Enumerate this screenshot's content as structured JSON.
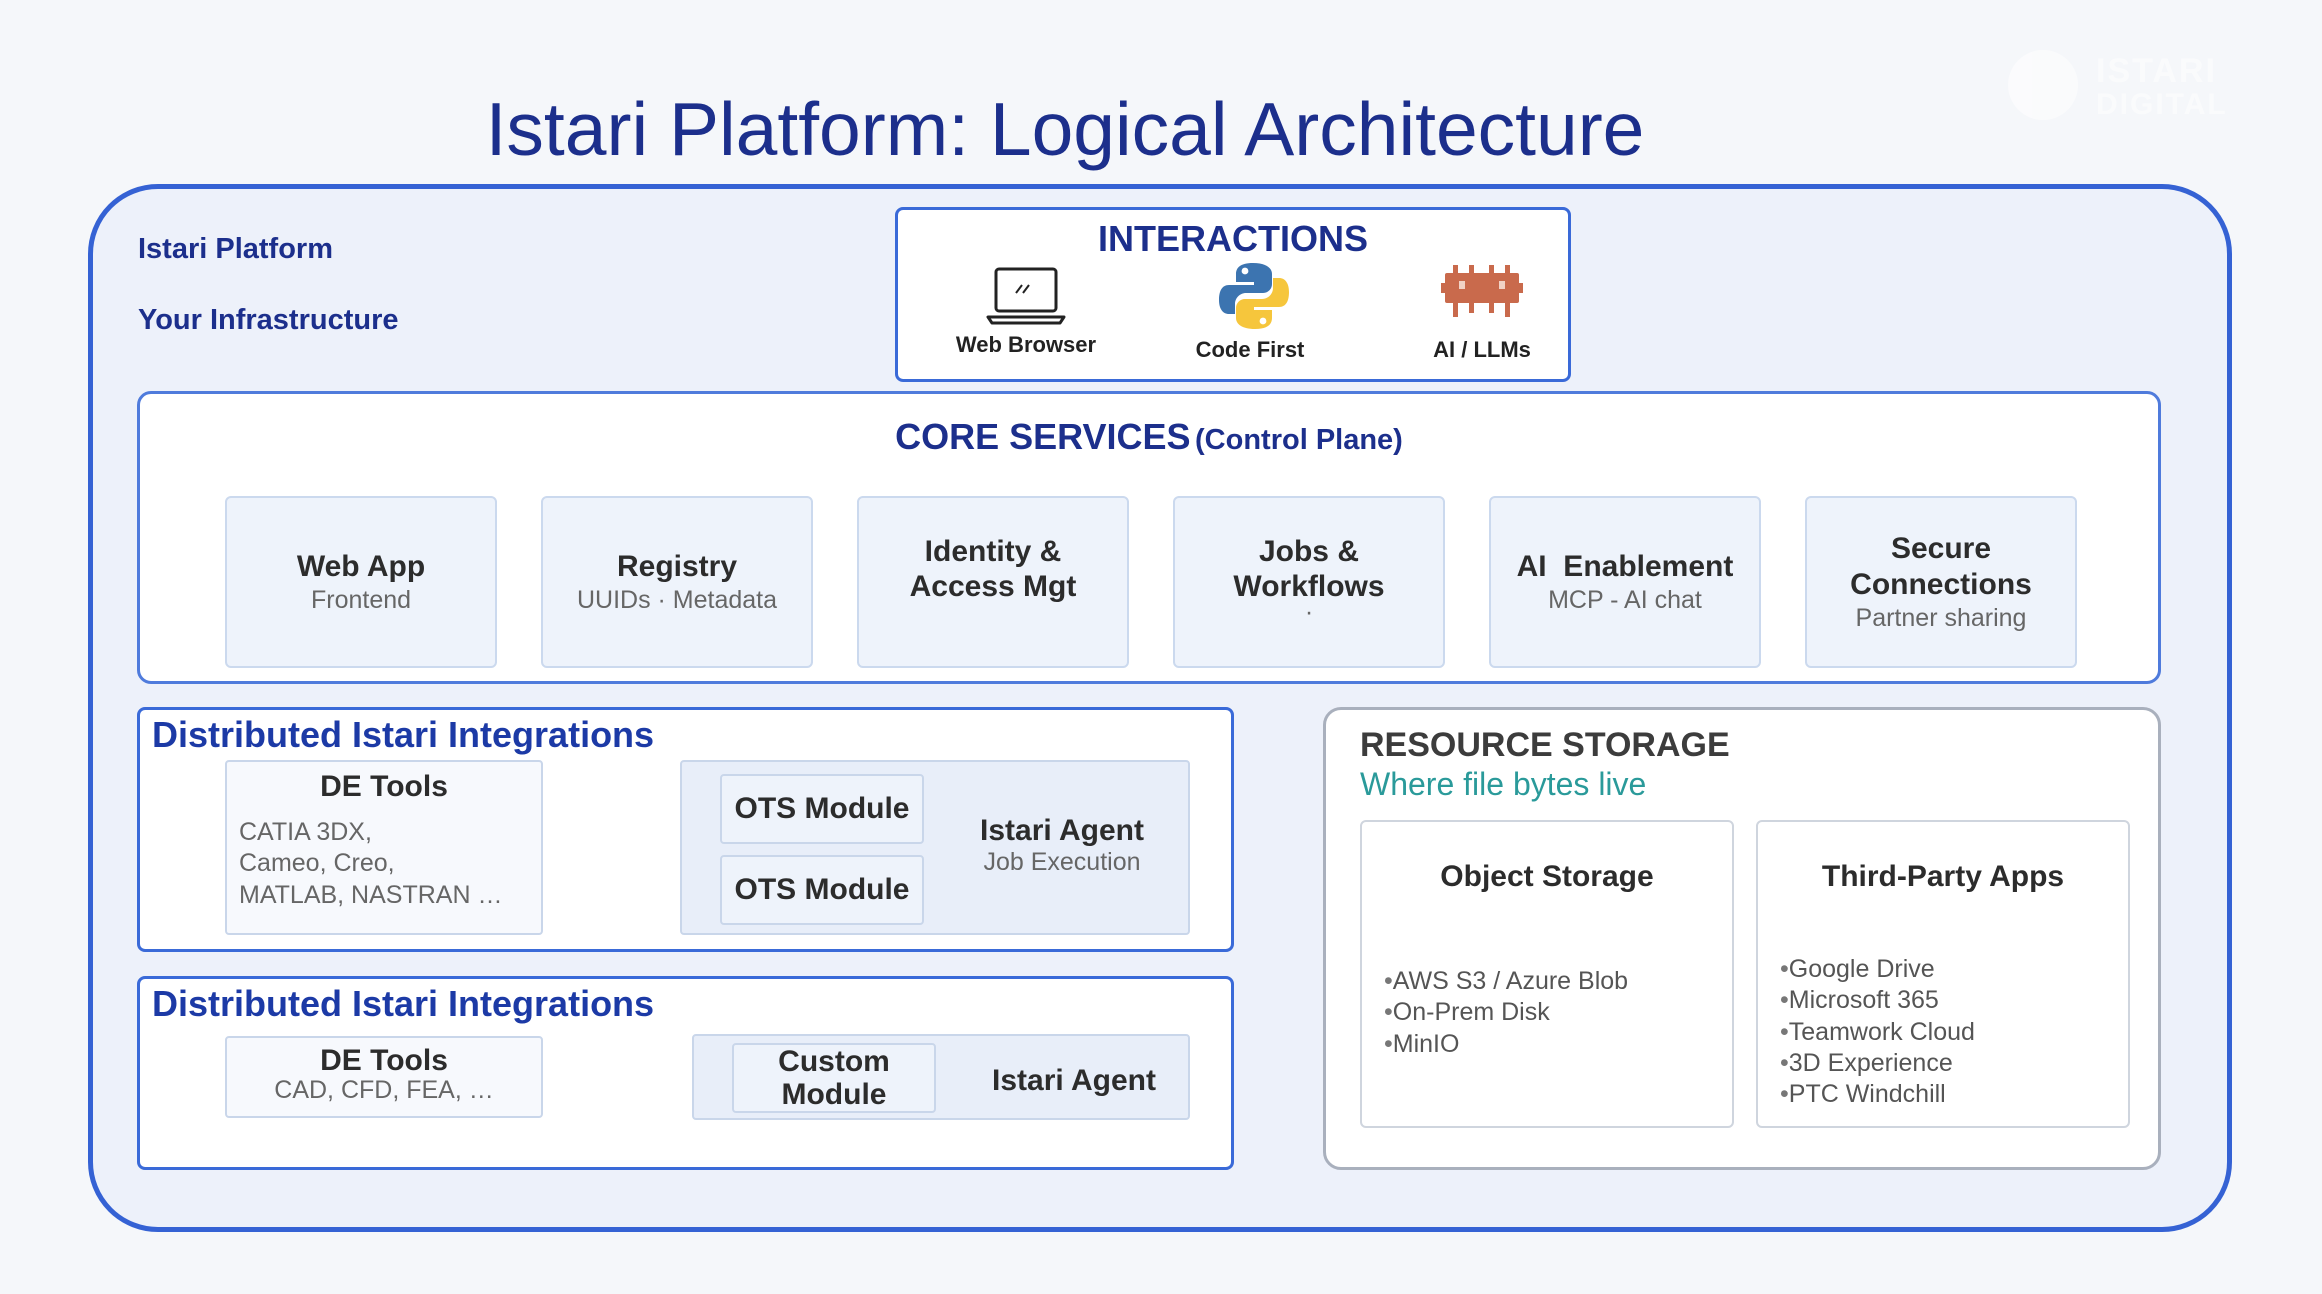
{
  "title": "Istari Platform: Logical Architecture",
  "logo": {
    "line1": "ISTARI",
    "line2": "DIGITAL"
  },
  "platform": {
    "label": "Istari Platform",
    "infra_label": "Your Infrastructure"
  },
  "interactions": {
    "title": "INTERACTIONS",
    "items": [
      {
        "label": "Web Browser",
        "icon": "laptop-icon"
      },
      {
        "label": "Code First",
        "icon": "python-icon"
      },
      {
        "label": "AI / LLMs",
        "icon": "chip-icon"
      }
    ]
  },
  "core": {
    "title": "CORE SERVICES",
    "subtitle": "(Control Plane)",
    "services": [
      {
        "title": "Web App",
        "sub": "Frontend"
      },
      {
        "title": "Registry",
        "sub": "UUIDs · Metadata"
      },
      {
        "title": "Identity &\nAccess Mgt",
        "sub": ""
      },
      {
        "title": "Jobs &\nWorkflows",
        "sub": "·"
      },
      {
        "title": "AI  Enablement",
        "sub": "MCP - AI chat"
      },
      {
        "title": "Secure\nConnections",
        "sub": "Partner sharing"
      }
    ]
  },
  "dist1": {
    "title": "Distributed Istari Integrations",
    "de_title": "DE Tools",
    "de_lines": [
      "CATIA 3DX,",
      "Cameo, Creo,",
      "MATLAB, NASTRAN …"
    ],
    "modules": [
      "OTS Module",
      "OTS Module"
    ],
    "agent_title": "Istari Agent",
    "agent_sub": "Job Execution"
  },
  "dist2": {
    "title": "Distributed Istari Integrations",
    "de_title": "DE Tools",
    "de_sub": "CAD, CFD, FEA, …",
    "module": "Custom\nModule",
    "agent_title": "Istari Agent"
  },
  "storage": {
    "title": "RESOURCE STORAGE",
    "subtitle": "Where file bytes live",
    "cards": [
      {
        "title": "Object Storage",
        "items": [
          "AWS S3 / Azure Blob",
          "On-Prem Disk",
          "MinIO"
        ]
      },
      {
        "title": "Third-Party Apps",
        "items": [
          "Google Drive",
          "Microsoft 365",
          "Teamwork Cloud",
          "3D Experience",
          "PTC Windchill"
        ]
      }
    ]
  },
  "colors": {
    "primary": "#1c2f8c",
    "border": "#3562d4",
    "teal": "#2a9a9a"
  }
}
